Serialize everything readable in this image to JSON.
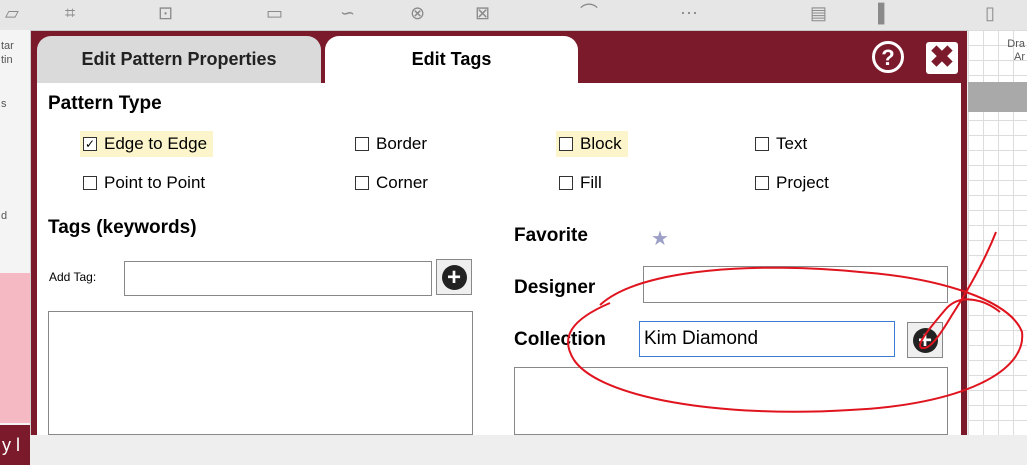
{
  "dialog": {
    "tabs": [
      {
        "label": "Edit Pattern Properties",
        "active": false
      },
      {
        "label": "Edit Tags",
        "active": true
      }
    ],
    "help_label": "?",
    "close_label": "✖"
  },
  "background": {
    "left_texts": [
      "tar",
      "tin",
      "s",
      "d"
    ],
    "right_texts": [
      "Dra",
      "Ar"
    ],
    "bottom_left_text": "y l"
  },
  "pattern_type": {
    "heading": "Pattern Type",
    "options": [
      {
        "label": "Edge to Edge",
        "checked": true,
        "highlighted": true
      },
      {
        "label": "Border",
        "checked": false,
        "highlighted": false
      },
      {
        "label": "Block",
        "checked": false,
        "highlighted": true
      },
      {
        "label": "Text",
        "checked": false,
        "highlighted": false
      },
      {
        "label": "Point to Point",
        "checked": false,
        "highlighted": false
      },
      {
        "label": "Corner",
        "checked": false,
        "highlighted": false
      },
      {
        "label": "Fill",
        "checked": false,
        "highlighted": false
      },
      {
        "label": "Project",
        "checked": false,
        "highlighted": false
      }
    ]
  },
  "tags": {
    "heading": "Tags (keywords)",
    "add_label": "Add Tag:",
    "add_value": ""
  },
  "favorite": {
    "label": "Favorite",
    "icon": "star-icon"
  },
  "designer": {
    "label": "Designer",
    "value": ""
  },
  "collection": {
    "label": "Collection",
    "value": "Kim Diamond"
  },
  "colors": {
    "accent": "#7b1a2a",
    "highlight": "#fcf5cc",
    "annotation": "#e0141e"
  }
}
